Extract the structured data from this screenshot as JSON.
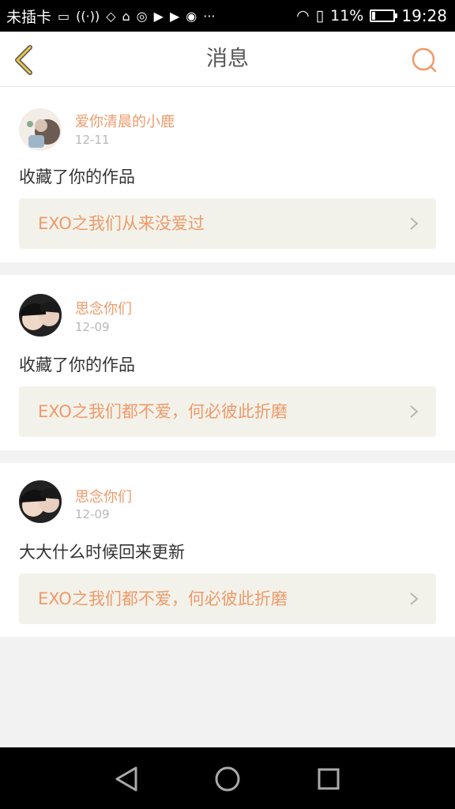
{
  "status_bar": {
    "carrier": "未插卡",
    "battery": "11%",
    "time": "19:28"
  },
  "header": {
    "title": "消息",
    "back_icon": "back-chevron-icon",
    "search_icon": "search-icon"
  },
  "messages": [
    {
      "user": "爱你清晨的小鹿",
      "date": "12-11",
      "text": "收藏了你的作品",
      "work": "EXO之我们从来没爱过"
    },
    {
      "user": "思念你们",
      "date": "12-09",
      "text": "收藏了你的作品",
      "work": "EXO之我们都不爱，何必彼此折磨"
    },
    {
      "user": "思念你们",
      "date": "12-09",
      "text": "大大什么时候回来更新",
      "work": "EXO之我们都不爱，何必彼此折磨"
    }
  ],
  "colors": {
    "accent": "#ee9a6a",
    "back_arrow": "#e8c64a",
    "work_bg": "#f3f2ea"
  }
}
